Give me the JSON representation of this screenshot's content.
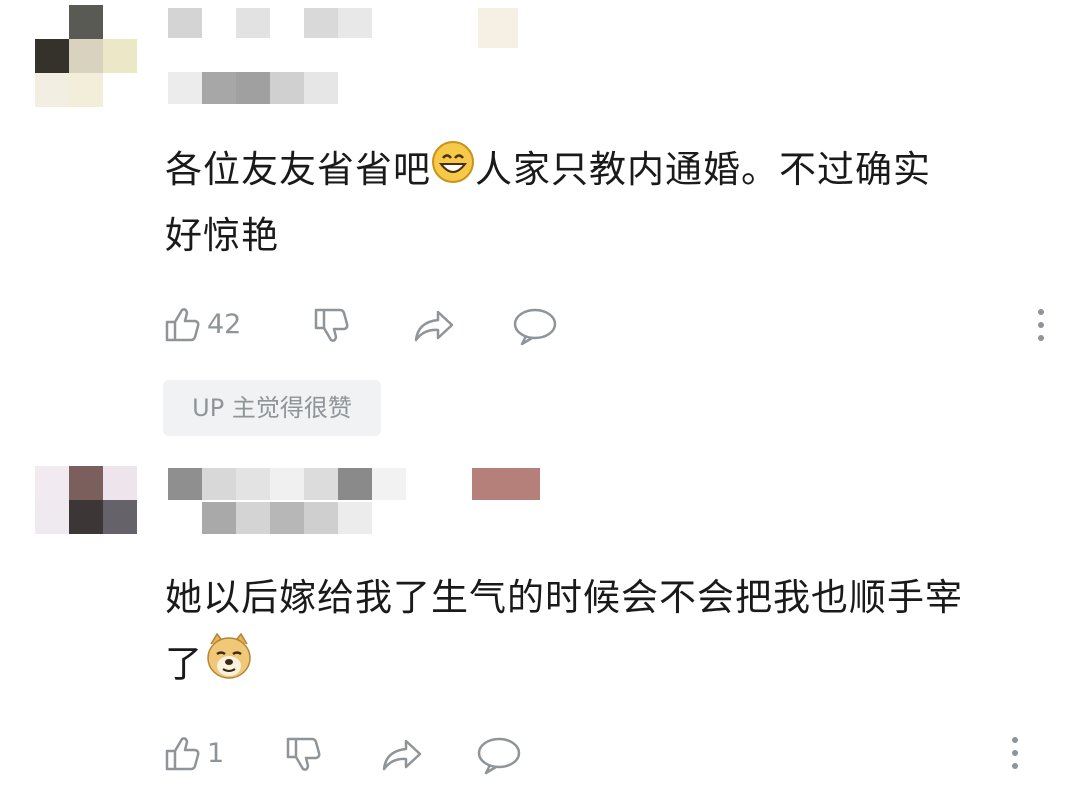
{
  "comments": [
    {
      "text_line1": "各位友友省省吧",
      "text_line1_after_emoji": "人家只教内通婚。不过确实",
      "text_line2": "好惊艳",
      "emoji": "grinning-face-emoji",
      "like_count": "42",
      "badge": "UP 主觉得很赞"
    },
    {
      "text_line1": "她以后嫁给我了生气的时候会不会把我也顺手宰",
      "text_line2": "了",
      "emoji": "doge-emoji",
      "like_count": "1"
    }
  ],
  "colors": {
    "icon_gray": "#8f9499",
    "badge_bg": "#f1f2f3",
    "text": "#1a1a1a"
  }
}
